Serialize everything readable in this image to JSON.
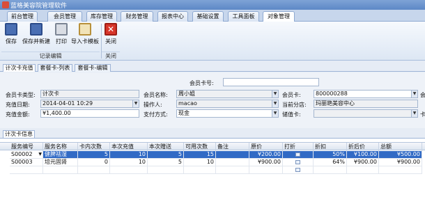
{
  "window": {
    "title": "蓝格美容院管理软件"
  },
  "menu_tabs": [
    "前台管理",
    "会员管理",
    "库存管理",
    "财务管理",
    "报表中心",
    "基础设置",
    "工具面板",
    "对象管理"
  ],
  "ribbon": {
    "buttons": {
      "save": "保存",
      "save_new": "保存并新建",
      "print": "打印",
      "import_template": "导入卡模板",
      "close": "关闭"
    },
    "groups": {
      "record_edit": "记录编辑",
      "close": "关闭"
    }
  },
  "doc_tabs": [
    "计次卡充值",
    "套餐卡-列表",
    "套餐卡-编辑"
  ],
  "form": {
    "member_no_label": "会员卡号:",
    "member_no_value": "",
    "card_type_label": "会员卡类型:",
    "card_type_value": "计次卡",
    "member_name_label": "会员名称:",
    "member_name_value": "周小姐",
    "member_card_label": "会员卡:",
    "member_card_value": "800000288",
    "member_extra_label": "会员",
    "recharge_date_label": "充值日期:",
    "recharge_date_value": "2014-04-01 10:29",
    "operator_label": "操作人:",
    "operator_value": "macao",
    "branch_label": "当前分店:",
    "branch_value": "玛丽艳美容中心",
    "amount_label": "充值金额:",
    "amount_value": "¥1,400.00",
    "pay_label": "支付方式:",
    "pay_value": "现金",
    "stored_card_label": "储值卡:",
    "stored_card_value": "",
    "card_extra_label": "卡内"
  },
  "section_tab": "计次卡信息",
  "table": {
    "headers": [
      "服务编号",
      "服务名称",
      "卡内次数",
      "本次充值",
      "本次赠送",
      "可用次数",
      "备注",
      "原价",
      "打折",
      "折扣",
      "折后价",
      "总额"
    ],
    "rows": [
      [
        "S00002",
        "健脾祛湿",
        "5",
        "10",
        "5",
        "15",
        "",
        "¥200.00",
        "",
        "50%",
        "¥100.00",
        "¥500.00"
      ],
      [
        "S00003",
        "培元固肾",
        "0",
        "10",
        "5",
        "10",
        "",
        "¥900.00",
        "",
        "64%",
        "¥900.00",
        "¥900.00"
      ]
    ]
  }
}
